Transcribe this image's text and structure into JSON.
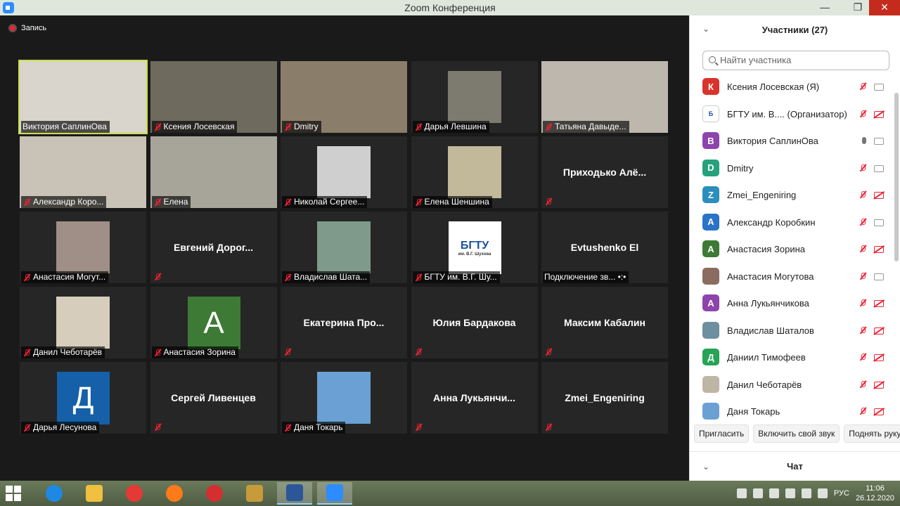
{
  "window": {
    "title": "Zoom Конференция",
    "minimize": "—",
    "maximize": "❐",
    "close": "✕"
  },
  "recording": {
    "label": "Запись"
  },
  "tiles": [
    {
      "name": "Виктория СаплинОва",
      "label": "Виктория СаплинОва",
      "muted": false,
      "active": true,
      "kind": "video",
      "bg": "#d9d4cc"
    },
    {
      "name": "Ксения Лосевская",
      "label": "Ксения Лосевская",
      "muted": true,
      "kind": "video",
      "bg": "#6f6a5e"
    },
    {
      "name": "Dmitry",
      "label": "Dmitry",
      "muted": true,
      "kind": "video",
      "bg": "#8a7d6a"
    },
    {
      "name": "Дарья Левшина",
      "label": "Дарья Левшина",
      "muted": true,
      "kind": "video-small",
      "bg": "#7d7b70"
    },
    {
      "name": "Татьяна Давыде...",
      "label": "Татьяна Давыде...",
      "muted": true,
      "kind": "video",
      "bg": "#bdb7ad"
    },
    {
      "name": "Александр Коро...",
      "label": "Александр Коро...",
      "muted": true,
      "kind": "video",
      "bg": "#c9c2b6"
    },
    {
      "name": "Елена",
      "label": "Елена",
      "muted": true,
      "kind": "video",
      "bg": "#a7a59a"
    },
    {
      "name": "Николай Сергее...",
      "label": "Николай Сергее...",
      "muted": true,
      "kind": "video-small",
      "bg": "#cfcfcf"
    },
    {
      "name": "Елена Шеншина",
      "label": "Елена Шеншина",
      "muted": true,
      "kind": "video-small",
      "bg": "#c2b89a"
    },
    {
      "name": "Приходько Алё...",
      "big": "Приходько  Алё...",
      "muted": true,
      "kind": "text"
    },
    {
      "name": "Анастасия Могут...",
      "label": "Анастасия Могут...",
      "muted": true,
      "kind": "video-small",
      "bg": "#a08f86"
    },
    {
      "name": "Евгений Дорог...",
      "big": "Евгений  Дорог...",
      "muted": true,
      "kind": "text"
    },
    {
      "name": "Владислав Шата...",
      "label": "Владислав Шата...",
      "muted": true,
      "kind": "video-small",
      "bg": "#7f9a8b"
    },
    {
      "name": "БГТУ им. В.Г. Шу...",
      "label": "БГТУ им.  В.Г. Шу...",
      "muted": true,
      "kind": "logo",
      "logo_text": "БГТУ",
      "logo_sub": "им. В.Г. Шухова"
    },
    {
      "name": "Evtushenko El",
      "big": "Evtushenko El",
      "label": "Подключение зв...  •:•",
      "muted": false,
      "kind": "text"
    },
    {
      "name": "Данил Чеботарёв",
      "label": "Данил Чеботарёв",
      "muted": true,
      "kind": "video-small",
      "bg": "#d6cdbd"
    },
    {
      "name": "Анастасия Зорина",
      "label": "Анастасия Зорина",
      "muted": true,
      "kind": "avatar",
      "letter": "A",
      "color": "#3d7a35"
    },
    {
      "name": "Екатерина Про...",
      "big": "Екатерина  Про...",
      "muted": true,
      "kind": "text"
    },
    {
      "name": "Юлия Бардакова",
      "big": "Юлия Бардакова",
      "muted": true,
      "kind": "text"
    },
    {
      "name": "Максим Кабалин",
      "big": "Максим Кабалин",
      "muted": true,
      "kind": "text"
    },
    {
      "name": "Дарья Лесунова",
      "label": "Дарья Лесунова",
      "muted": true,
      "kind": "avatar",
      "letter": "Д",
      "color": "#1560a8"
    },
    {
      "name": "Сергей Ливенцев",
      "big": "Сергей Ливенцев",
      "muted": true,
      "kind": "text"
    },
    {
      "name": "Даня Токарь",
      "label": "Даня Токарь",
      "muted": true,
      "kind": "video-small",
      "bg": "#6aa0d4"
    },
    {
      "name": "Анна Лукьянчи...",
      "big": "Анна  Лукьянчи...",
      "muted": true,
      "kind": "text"
    },
    {
      "name": "Zmei_Engeniring",
      "big": "Zmei_Engeniring",
      "muted": true,
      "kind": "text"
    }
  ],
  "participants": {
    "title": "Участники (27)",
    "search_placeholder": "Найти участника",
    "items": [
      {
        "name": "Ксения Лосевская (Я)",
        "letter": "К",
        "color": "#d9342b",
        "mic": "muted",
        "cam": "on"
      },
      {
        "name": "БГТУ им.  В....  (Организатор)",
        "letter": "Б",
        "color": "#ffffff",
        "logo": true,
        "mic": "muted",
        "cam": "off"
      },
      {
        "name": "Виктория СаплинОва",
        "letter": "В",
        "color": "#8e44ad",
        "mic": "on",
        "cam": "on"
      },
      {
        "name": "Dmitry",
        "letter": "D",
        "color": "#26a17b",
        "mic": "muted",
        "cam": "on"
      },
      {
        "name": "Zmei_Engeniring",
        "letter": "Z",
        "color": "#2a8fbd",
        "mic": "muted",
        "cam": "off"
      },
      {
        "name": "Александр Коробкин",
        "letter": "А",
        "color": "#2a73c7",
        "mic": "muted",
        "cam": "on"
      },
      {
        "name": "Анастасия Зорина",
        "letter": "А",
        "color": "#3d7a35",
        "mic": "muted",
        "cam": "off"
      },
      {
        "name": "Анастасия Могутова",
        "letter": "",
        "color": "#8a6d60",
        "photo": true,
        "mic": "muted",
        "cam": "on"
      },
      {
        "name": "Анна Лукьянчикова",
        "letter": "А",
        "color": "#8e44ad",
        "mic": "muted",
        "cam": "off"
      },
      {
        "name": "Владислав Шаталов",
        "letter": "",
        "color": "#6d8fa0",
        "photo": true,
        "mic": "muted",
        "cam": "off"
      },
      {
        "name": "Даниил Тимофеев",
        "letter": "Д",
        "color": "#27a456",
        "mic": "muted",
        "cam": "off"
      },
      {
        "name": "Данил Чеботарёв",
        "letter": "",
        "color": "#bfb5a5",
        "photo": true,
        "mic": "muted",
        "cam": "off"
      },
      {
        "name": "Даня Токарь",
        "letter": "",
        "color": "#6aa0d4",
        "photo": true,
        "mic": "muted",
        "cam": "off"
      }
    ],
    "buttons": {
      "invite": "Пригласить",
      "unmute": "Включить свой звук",
      "raise": "Поднять руку"
    }
  },
  "chat": {
    "title": "Чат"
  },
  "taskbar": {
    "apps": [
      {
        "name": "internet-explorer",
        "color": "#1e88e5"
      },
      {
        "name": "file-explorer",
        "color": "#f0c040"
      },
      {
        "name": "chrome",
        "color": "#e53935"
      },
      {
        "name": "firefox",
        "color": "#ff7a18"
      },
      {
        "name": "opera",
        "color": "#d32f2f"
      },
      {
        "name": "archive",
        "color": "#c79a3a"
      },
      {
        "name": "word",
        "color": "#2b579a",
        "active": true
      },
      {
        "name": "zoom",
        "color": "#2d8cff",
        "active": true
      }
    ],
    "lang": "РУС",
    "time": "11:06",
    "date": "26.12.2020"
  }
}
